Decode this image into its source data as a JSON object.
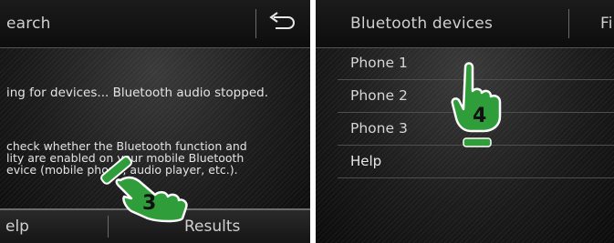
{
  "left_screen": {
    "header_title": "earch",
    "status_message": "ing for devices... Bluetooth audio stopped.",
    "help_lines": [
      "check whether the Bluetooth function and",
      "lity are enabled on your mobile Bluetooth",
      "evice (mobile phone, audio player, etc.)."
    ],
    "bottom_bar": {
      "left_label": "elp",
      "right_label": "Results"
    },
    "callout_number": "3"
  },
  "right_screen": {
    "header_title": "Bluetooth devices",
    "header_right_fragment": "Fi",
    "devices": [
      {
        "label": "Phone 1"
      },
      {
        "label": "Phone 2"
      },
      {
        "label": "Phone 3"
      }
    ],
    "help_label": "Help",
    "callout_number": "4"
  },
  "colors": {
    "callout_fill": "#2f9e3a",
    "callout_outline": "#ffffff",
    "screen_bg": "#1c1c1c",
    "text": "#d8d8d8"
  },
  "icons": {
    "back": "back-arrow-icon",
    "pointer": "pointing-hand-icon"
  }
}
